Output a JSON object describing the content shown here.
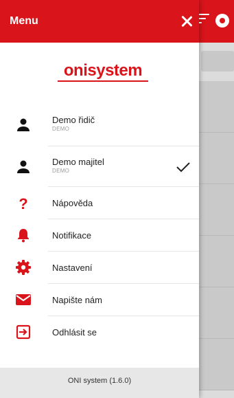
{
  "drawer": {
    "title": "Menu",
    "logo_text": "onisystem",
    "users": [
      {
        "name": "Demo řidič",
        "role": "DEMO",
        "icon": "person-icon",
        "selected": false
      },
      {
        "name": "Demo majitel",
        "role": "DEMO",
        "icon": "person-icon",
        "selected": true
      }
    ],
    "menu": [
      {
        "label": "Nápověda",
        "icon": "help-icon"
      },
      {
        "label": "Notifikace",
        "icon": "bell-icon"
      },
      {
        "label": "Nastavení",
        "icon": "gear-icon"
      },
      {
        "label": "Napište nám",
        "icon": "mail-icon"
      },
      {
        "label": "Odhlásit se",
        "icon": "logout-icon"
      }
    ],
    "footer": "ONI system (1.6.0)"
  },
  "colors": {
    "accent": "#d9141b",
    "text": "#222222",
    "muted": "#9a9a9a"
  }
}
